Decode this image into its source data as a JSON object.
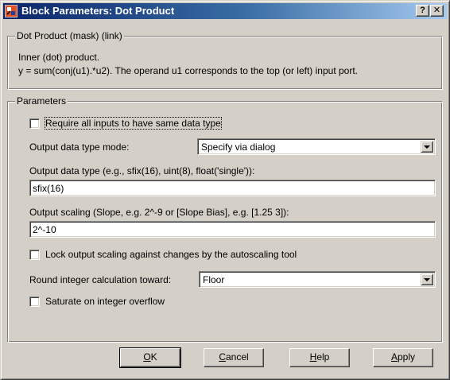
{
  "window": {
    "title": "Block Parameters: Dot Product",
    "help_button": "?",
    "close_button": "✕"
  },
  "mask_group": {
    "legend": "Dot Product (mask) (link)",
    "description_line1": "Inner (dot) product.",
    "description_line2": "y = sum(conj(u1).*u2). The operand u1 corresponds to the top (or left) input port."
  },
  "params_group": {
    "legend": "Parameters",
    "require_same_type": {
      "label": "Require all inputs to have same data type",
      "checked": false
    },
    "output_mode": {
      "label": "Output data type mode:",
      "value": "Specify via dialog"
    },
    "output_type": {
      "label": "Output data type (e.g., sfix(16),  uint(8),  float('single')):",
      "value": "sfix(16)"
    },
    "output_scaling": {
      "label": "Output scaling (Slope, e.g. 2^-9 or [Slope Bias], e.g. [1.25 3]):",
      "value": "2^-10"
    },
    "lock_scaling": {
      "label": "Lock output scaling against changes by the autoscaling tool",
      "checked": false
    },
    "round_toward": {
      "label": "Round integer calculation toward:",
      "value": "Floor"
    },
    "saturate": {
      "label": "Saturate on integer overflow",
      "checked": false
    }
  },
  "buttons": {
    "ok": {
      "first": "O",
      "rest": "K"
    },
    "cancel": {
      "first": "C",
      "rest": "ancel"
    },
    "help": {
      "first": "H",
      "rest": "elp"
    },
    "apply": {
      "first": "A",
      "rest": "pply"
    }
  },
  "colors": {
    "face": "#d4d0c8",
    "title_start": "#0a246a",
    "title_end": "#a6caf0"
  }
}
